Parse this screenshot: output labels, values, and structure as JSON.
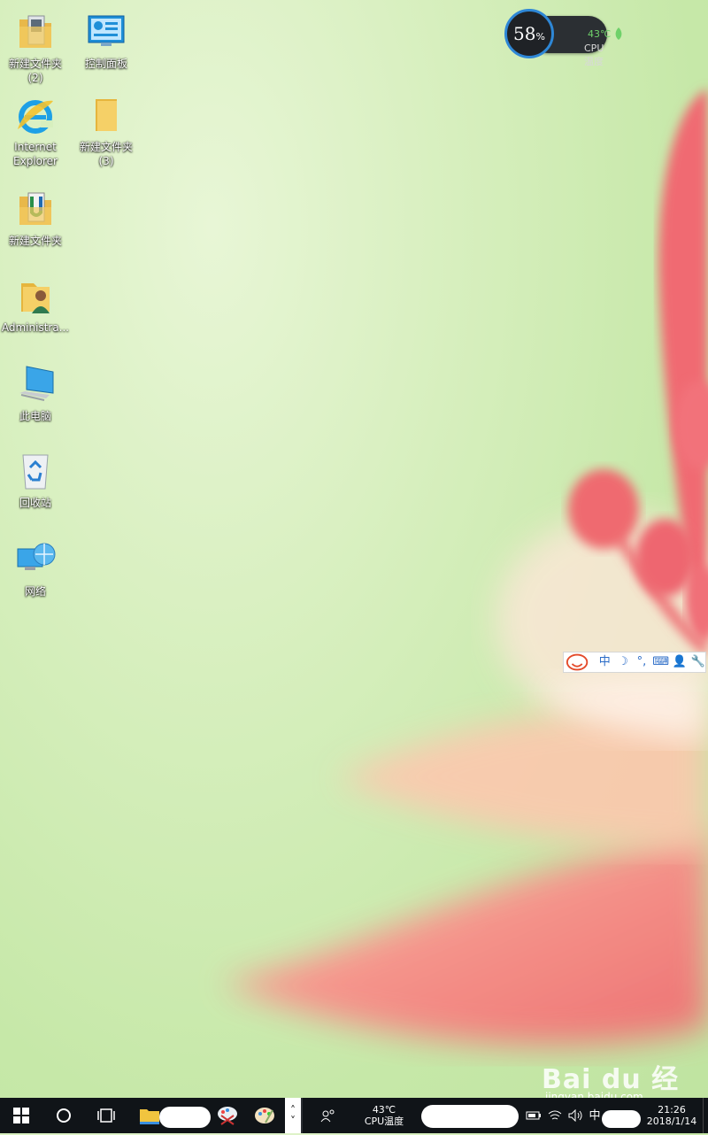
{
  "desktop": {
    "icons": [
      {
        "label": "新建文件夹\n(2)",
        "icon": "folder-with-files-icon"
      },
      {
        "label": "控制面板",
        "icon": "control-panel-icon"
      },
      {
        "label": "Internet\nExplorer",
        "icon": "internet-explorer-icon"
      },
      {
        "label": "新建文件夹\n(3)",
        "icon": "folder-icon"
      },
      {
        "label": "新建文件夹",
        "icon": "folder-with-app-icon"
      },
      {
        "label": "Administra...",
        "icon": "user-folder-icon"
      },
      {
        "label": "此电脑",
        "icon": "computer-icon"
      },
      {
        "label": "回收站",
        "icon": "recycle-bin-icon"
      },
      {
        "label": "网络",
        "icon": "network-icon"
      }
    ]
  },
  "cpu_widget": {
    "usage": "58",
    "usage_unit": "%",
    "temperature": "43℃",
    "label": "CPU温度",
    "ring_color": "#2e87d6",
    "temp_color": "#6fd16a"
  },
  "ime_toolbar": {
    "items": [
      "中",
      "☽",
      "°,",
      "⌨",
      "👤",
      "🔧"
    ]
  },
  "taskbar": {
    "cpu_temp": "43℃",
    "cpu_label": "CPU温度",
    "ime_indicator": "中",
    "time": "21:26",
    "date": "2018/1/14",
    "overflow_arrow": "^"
  },
  "watermark": {
    "brand": "Bai du 经验",
    "url": "jingyan.baidu.com"
  },
  "colors": {
    "taskbar_bg": "#101418",
    "wallpaper_green": "#d7efbe",
    "flower_pink": "#f0737a"
  }
}
